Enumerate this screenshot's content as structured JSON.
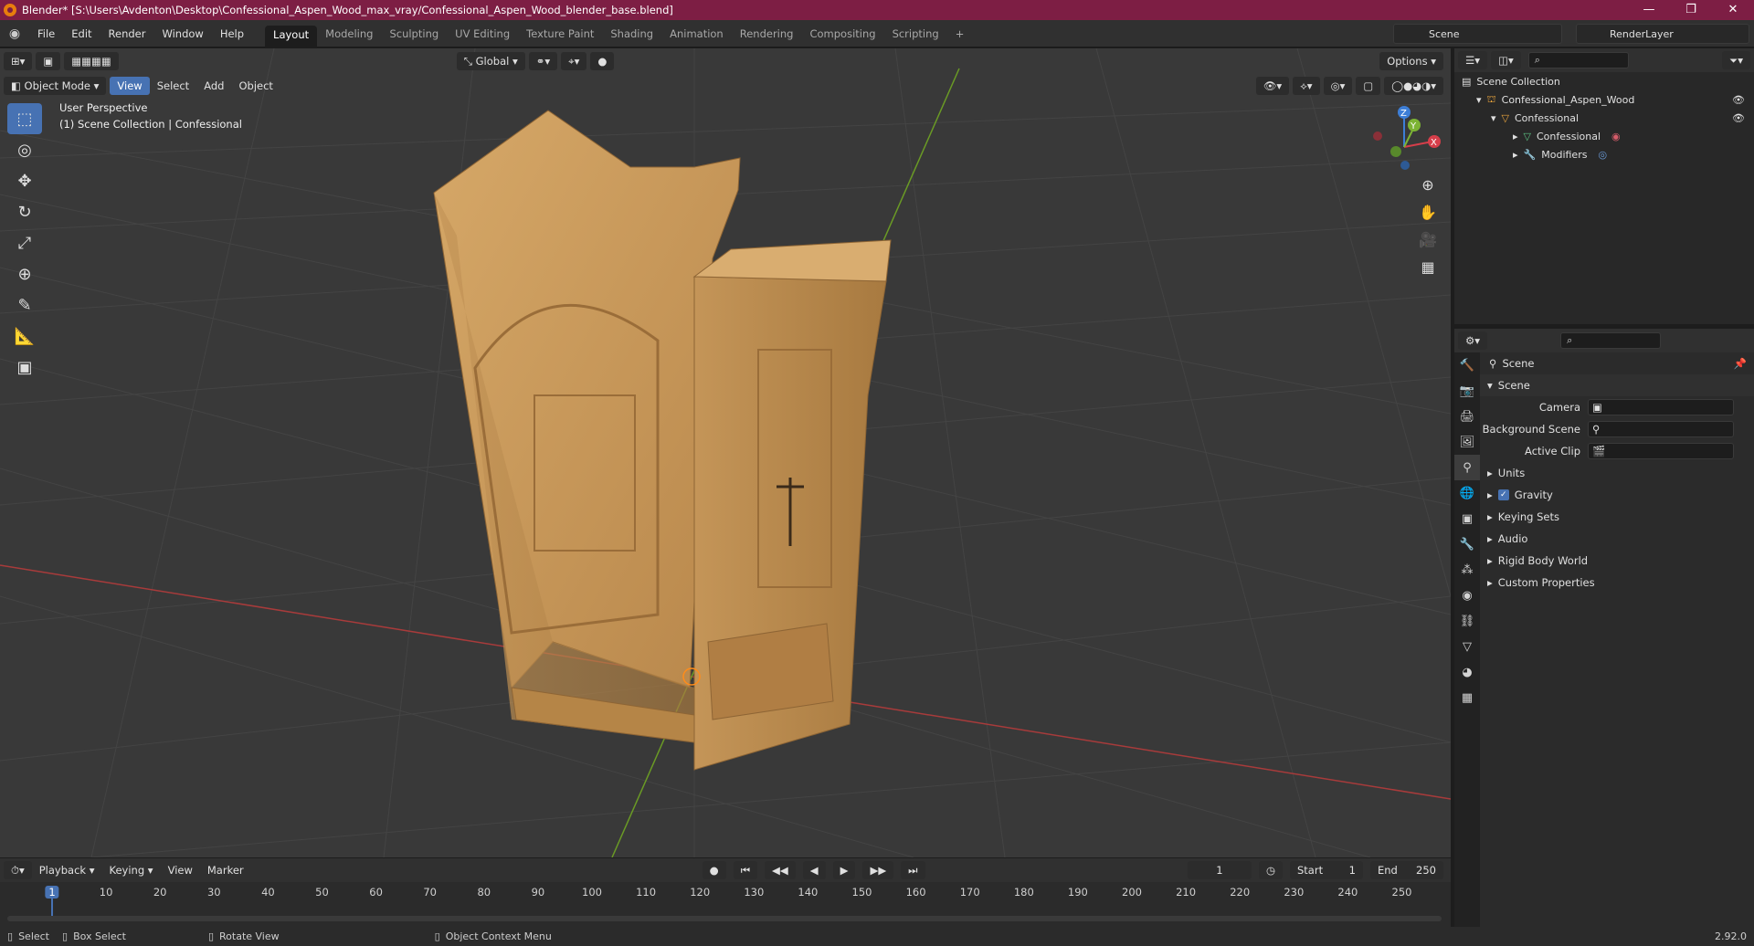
{
  "window": {
    "title": "Blender* [S:\\Users\\Avdenton\\Desktop\\Confessional_Aspen_Wood_max_vray/Confessional_Aspen_Wood_blender_base.blend]",
    "minimize": "—",
    "maximize": "❐",
    "close": "✕"
  },
  "menu": {
    "items": [
      "File",
      "Edit",
      "Render",
      "Window",
      "Help"
    ]
  },
  "workspaces": [
    "Layout",
    "Modeling",
    "Sculpting",
    "UV Editing",
    "Texture Paint",
    "Shading",
    "Animation",
    "Rendering",
    "Compositing",
    "Scripting"
  ],
  "workspace_add": "+",
  "scene": "Scene",
  "render_layer": "RenderLayer",
  "viewport": {
    "mode": "Object Mode",
    "menu": [
      "View",
      "Select",
      "Add",
      "Object"
    ],
    "transform": "Global",
    "options": "Options",
    "info_line1": "User Perspective",
    "info_line2": "(1) Scene Collection | Confessional",
    "gizmo": {
      "z": "Z",
      "y": "Y",
      "x": "X"
    }
  },
  "outliner": {
    "rows": [
      {
        "label": "Scene Collection",
        "indent": 0
      },
      {
        "label": "Confessional_Aspen_Wood",
        "indent": 1
      },
      {
        "label": "Confessional",
        "indent": 2
      },
      {
        "label": "Confessional",
        "indent": 3
      },
      {
        "label": "Modifiers",
        "indent": 3
      }
    ]
  },
  "properties": {
    "breadcrumb": "Scene",
    "panel": "Scene",
    "fields": [
      {
        "label": "Camera"
      },
      {
        "label": "Background Scene"
      },
      {
        "label": "Active Clip"
      }
    ],
    "sections": [
      "Units",
      "Gravity",
      "Keying Sets",
      "Audio",
      "Rigid Body World",
      "Custom Properties"
    ]
  },
  "timeline": {
    "menu": [
      "Playback",
      "Keying",
      "View",
      "Marker"
    ],
    "current_frame": "1",
    "start_label": "Start",
    "start": "1",
    "end_label": "End",
    "end": "250",
    "ruler": [
      "1",
      "10",
      "20",
      "30",
      "40",
      "50",
      "60",
      "70",
      "80",
      "90",
      "100",
      "110",
      "120",
      "130",
      "140",
      "150",
      "160",
      "170",
      "180",
      "190",
      "200",
      "210",
      "220",
      "230",
      "240",
      "250"
    ]
  },
  "status": {
    "select": "Select",
    "box_select": "Box Select",
    "rotate": "Rotate View",
    "context": "Object Context Menu",
    "version": "2.92.0"
  },
  "colors": {
    "accent": "#4772b3",
    "title_bar": "#7d1e44",
    "x_axis": "#a83b3b",
    "y_axis": "#6a9a25",
    "wood": "#c79a5c"
  }
}
